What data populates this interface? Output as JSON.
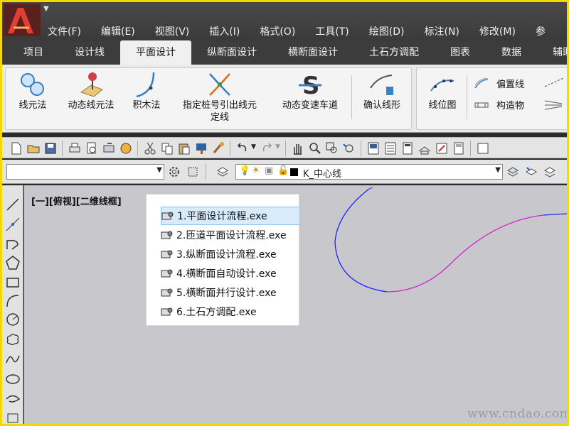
{
  "menubar": {
    "items": [
      "文件(F)",
      "编辑(E)",
      "视图(V)",
      "插入(I)",
      "格式(O)",
      "工具(T)",
      "绘图(D)",
      "标注(N)",
      "修改(M)",
      "参"
    ]
  },
  "tabs": {
    "items": [
      "项目",
      "设计线",
      "平面设计",
      "纵断面设计",
      "横断面设计",
      "土石方调配",
      "图表",
      "数据",
      "辅助"
    ],
    "active_index": 2
  },
  "ribbon": {
    "buttons": [
      {
        "label": "线元法",
        "icon": "circles-icon"
      },
      {
        "label": "动态线元法",
        "icon": "pin-map-icon"
      },
      {
        "label": "积木法",
        "icon": "arc-curve-icon"
      },
      {
        "label": "指定桩号引出线元",
        "label2": "定线",
        "icon": "cross-curve-icon"
      },
      {
        "label": "动态变速车道",
        "icon": "strikethrough-s-icon"
      },
      {
        "label": "确认线形",
        "icon": "confirm-curve-icon"
      },
      {
        "label": "线位图",
        "icon": "alignment-plot-icon"
      }
    ],
    "small_buttons": [
      {
        "label": "偏置线",
        "icon": "offset-line-icon"
      },
      {
        "label": "构造物",
        "icon": "structure-icon"
      }
    ]
  },
  "toolbar2": {
    "layer_combo_value": "",
    "current_layer": "K_中心线"
  },
  "canvas": {
    "viewport_label": "[一][俯视][二维线框]"
  },
  "popup": {
    "items": [
      "1.平面设计流程.exe",
      "2.匝道平面设计流程.exe",
      "3.纵断面设计流程.exe",
      "4.横断面自动设计.exe",
      "5.横断面并行设计.exe",
      "6.土石方调配.exe"
    ],
    "selected_index": 0
  },
  "watermark": "www.cndao.com",
  "colors": {
    "frame_border": "#f5d800",
    "curve_blue": "#2020ff",
    "curve_magenta": "#d020d0",
    "selection": "#d7ebfa"
  }
}
